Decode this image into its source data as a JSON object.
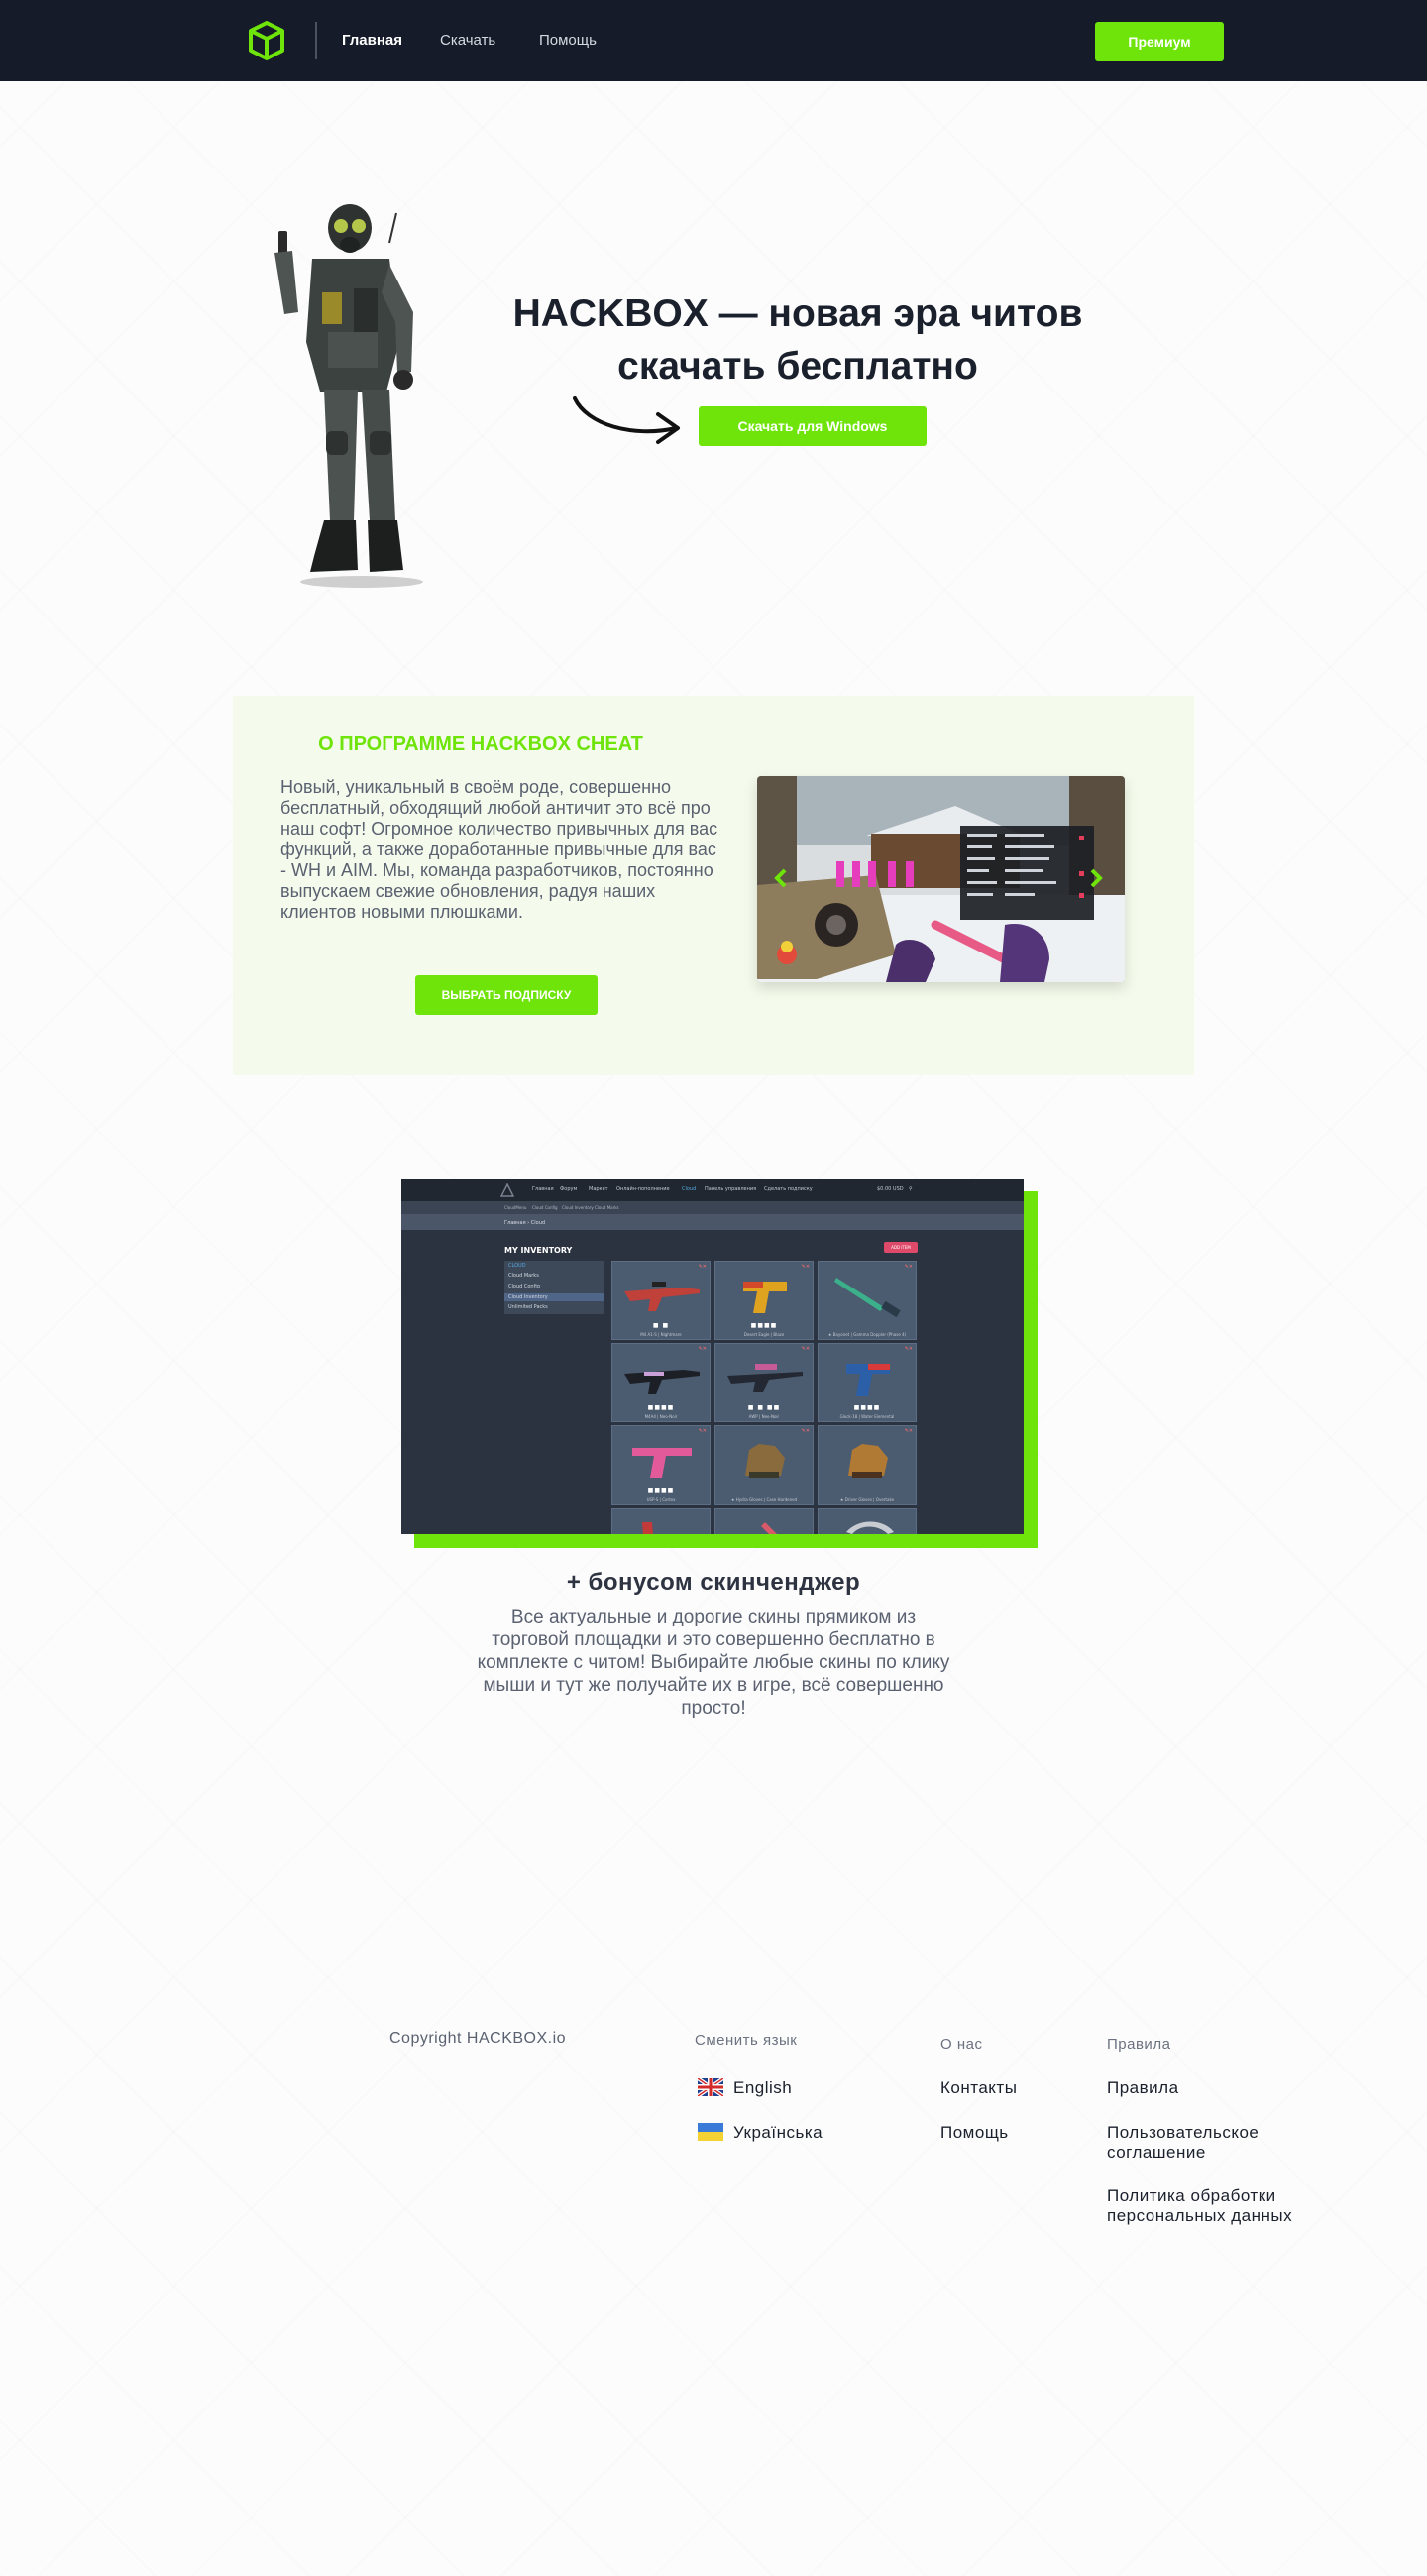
{
  "header": {
    "logo_icon": "cube-icon",
    "nav": [
      "Главная",
      "Скачать",
      "Помощь"
    ],
    "premium_label": "Премиум"
  },
  "hero": {
    "title_line1": "HACKBOX — новая эра читов",
    "title_line2": "скачать бесплатно",
    "download_label": "Скачать для Windows"
  },
  "about": {
    "title": "О ПРОГРАММЕ HACKBOX CHEAT",
    "text": "Новый, уникальный в своём роде, совершенно бесплатный, обходящий любой античит это всё про наш софт! Огромное количество привычных для вас функций, а также доработанные привычные для вас - WH и AIM. Мы, команда разработчиков, постоянно выпускаем свежие обновления, радуя наших клиентов новыми плюшками.",
    "button_label": "ВЫБРАТЬ ПОДПИСКУ"
  },
  "inventory": {
    "nav": [
      "Главная",
      "Форум",
      "Маркет",
      "Онлайн-пополнение",
      "Cloud",
      "Панель управления",
      "Сделать подписку"
    ],
    "balance": "$0.00 USD",
    "subnav": [
      "CloudMenu",
      "Cloud Config",
      "Cloud Inventory",
      "Cloud Marks"
    ],
    "breadcrumb": "Главная  ›  Cloud",
    "heading": "MY INVENTORY",
    "add_button": "ADD ITEM",
    "sidebar": [
      "CLOUD",
      "Cloud Marks",
      "Cloud Config",
      "Cloud Inventory",
      "Unlimited Packs"
    ],
    "cards": [
      {
        "caption": "M4 A1-S | Nightmare",
        "stickers": "■        ■"
      },
      {
        "caption": "Desert Eagle | Blaze",
        "stickers": "■■■■"
      },
      {
        "caption": "★ Bayonet | Gamma Doppler (Phase 4)",
        "stickers": ""
      },
      {
        "caption": "M4A4 | Neo-Noir",
        "stickers": "■■■■"
      },
      {
        "caption": "AWP | Neo-Noir",
        "stickers": "■  ■ ■■"
      },
      {
        "caption": "Glock-18 | Water Elemental",
        "stickers": "■■■■"
      },
      {
        "caption": "USP-S | Cortex",
        "stickers": "■■■■"
      },
      {
        "caption": "★ Hydra Gloves | Case Hardened",
        "stickers": ""
      },
      {
        "caption": "★ Driver Gloves | Overtake",
        "stickers": ""
      }
    ]
  },
  "bonus": {
    "title": "+ бонусом скинченджер",
    "text": "Все актуальные и дорогие скины прямиком из торговой площадки и это совершенно бесплатно в комплекте с читом! Выбирайте любые скины по клику мыши и тут же получайте их в игре, всё совершенно просто!"
  },
  "footer": {
    "copyright": "Copyright HACKBOX.io",
    "lang_heading": "Сменить язык",
    "langs": [
      {
        "label": "English",
        "flag": "uk-flag-icon"
      },
      {
        "label": "Українська",
        "flag": "ukraine-flag-icon"
      }
    ],
    "about_heading": "О нас",
    "about_links": [
      "Контакты",
      "Помощь"
    ],
    "rules_heading": "Правила",
    "rules_links": [
      "Правила",
      "Пользовательское соглашение",
      "Политика обработки персональных данных"
    ]
  },
  "colors": {
    "accent": "#6ee40a",
    "header_bg": "#151b28",
    "about_bg": "#f5fbec"
  }
}
